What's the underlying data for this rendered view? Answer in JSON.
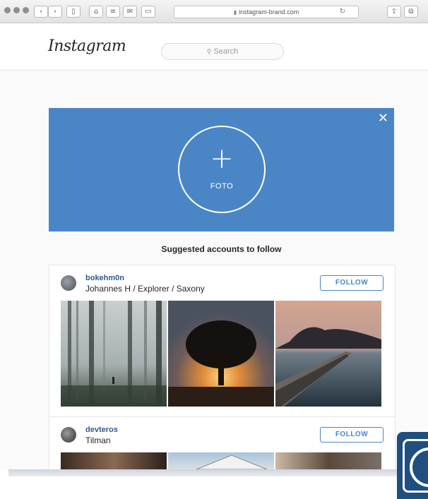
{
  "browser": {
    "url": "instagram-brand.com"
  },
  "header": {
    "logo": "Instagram",
    "search_placeholder": "Search"
  },
  "upload": {
    "label": "FOTO"
  },
  "suggested": {
    "heading": "Suggested accounts to follow",
    "accounts": [
      {
        "username": "bokehm0n",
        "full_name": "Johannes H / Explorer / Saxony",
        "button": "FOLLOW"
      },
      {
        "username": "devteros",
        "full_name": "Tilman",
        "button": "FOLLOW"
      }
    ]
  },
  "colors": {
    "accent": "#4a86c6",
    "app_icon": "#1f4f7e"
  }
}
